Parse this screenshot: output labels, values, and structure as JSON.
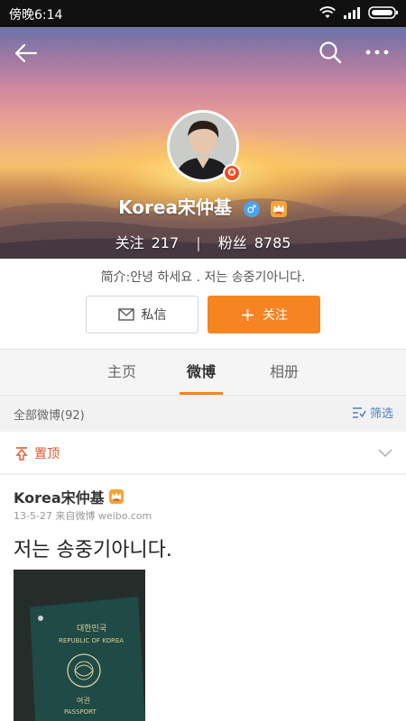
{
  "status_bar": {
    "time": "傍晚6:14"
  },
  "header": {
    "display_name": "Korea宋仲基",
    "gender_symbol": "♂",
    "following_label": "关注",
    "following_count": "217",
    "followers_label": "粉丝",
    "followers_count": "8785",
    "vip_mark": "✪"
  },
  "profile": {
    "intro": "简介:안녕 하세요 . 저는 송중기아니다.",
    "message_button": "私信",
    "follow_button": "关注",
    "follow_plus": "+"
  },
  "tabs": [
    {
      "label": "主页"
    },
    {
      "label": "微博"
    },
    {
      "label": "相册"
    }
  ],
  "filter": {
    "count_label": "全部微博(92)",
    "filter_button": "筛选"
  },
  "pinned": {
    "label": "置顶"
  },
  "post": {
    "author": "Korea宋仲基",
    "meta": "13-5-27  来自微博 weibo.com",
    "text": "저는 송중기아니다.",
    "image_text_1": "대한민국",
    "image_text_2": "REPUBLIC OF KOREA",
    "image_text_3": "여권",
    "image_text_4": "PASSPORT"
  },
  "colors": {
    "accent": "#f68521",
    "link_blue": "#4a7fc1",
    "pinned_red": "#e8562a"
  }
}
